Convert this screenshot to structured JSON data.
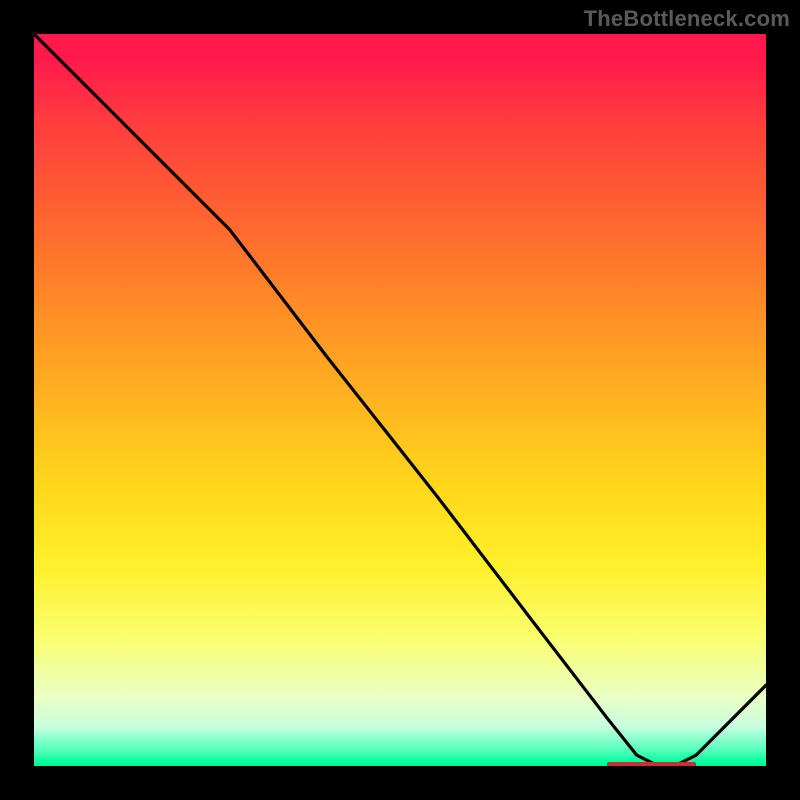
{
  "watermark": "TheBottleneck.com",
  "colors": {
    "background": "#000000",
    "curve": "#000000",
    "marker": "#cc2d3a"
  },
  "chart_data": {
    "type": "line",
    "title": "",
    "xlabel": "",
    "ylabel": "",
    "xlim": [
      0,
      100
    ],
    "ylim": [
      0,
      100
    ],
    "grid": false,
    "legend": null,
    "series": [
      {
        "name": "bottleneck-curve",
        "x": [
          0,
          6,
          12,
          20,
          27,
          40,
          55,
          68,
          78,
          82,
          86,
          90,
          100
        ],
        "values": [
          100,
          94,
          88,
          80,
          73,
          56,
          37,
          20,
          7,
          2,
          0,
          2,
          12
        ]
      }
    ],
    "marker": {
      "x_start": 78,
      "x_end": 90,
      "y": 0.5
    },
    "annotations": []
  }
}
